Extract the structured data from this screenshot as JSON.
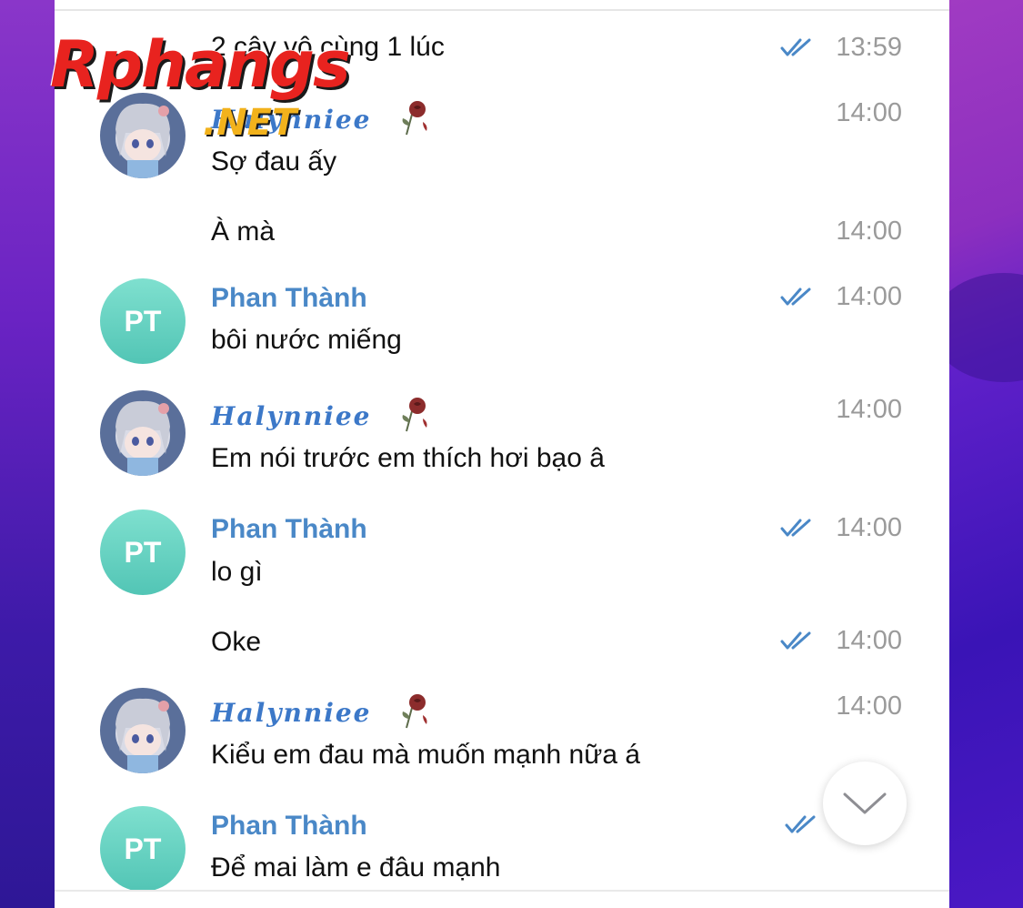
{
  "watermark": {
    "brand": "Rphangs",
    "tld": ".NET"
  },
  "messages": [
    {
      "kind": "continuation",
      "text": "2 cây vô cùng 1 lúc",
      "time": "13:59",
      "read": true
    },
    {
      "kind": "header",
      "sender": "Halynniee",
      "avatar": "anime",
      "text": "Sợ đau ấy",
      "time": "14:00",
      "read": false
    },
    {
      "kind": "continuation",
      "text": "À mà",
      "time": "14:00",
      "read": false
    },
    {
      "kind": "header",
      "sender": "Phan Thành",
      "avatar": "PT",
      "text": "bôi nước miếng",
      "time": "14:00",
      "read": true
    },
    {
      "kind": "header",
      "sender": "Halynniee",
      "avatar": "anime",
      "text": "Em nói trước em thích hơi bạo â",
      "time": "14:00",
      "read": false
    },
    {
      "kind": "header",
      "sender": "Phan Thành",
      "avatar": "PT",
      "text": "lo gì",
      "time": "14:00",
      "read": true
    },
    {
      "kind": "continuation",
      "text": "Oke",
      "time": "14:00",
      "read": true
    },
    {
      "kind": "header",
      "sender": "Halynniee",
      "avatar": "anime",
      "text": "Kiểu em đau mà muốn mạnh nữa á",
      "time": "14:00",
      "read": false
    },
    {
      "kind": "header",
      "sender": "Phan Thành",
      "avatar": "PT",
      "text": "Để mai làm e đâu mạnh",
      "time": "",
      "read": true
    }
  ],
  "colors": {
    "sender_name": "#4a88c7",
    "read_check": "#4a88c7",
    "time": "#9a9a9a",
    "pt_avatar": "#5ccbbb"
  },
  "icons": {
    "read": "double-check-icon",
    "scroll": "chevron-down-icon",
    "decoration": "rose-icon"
  }
}
